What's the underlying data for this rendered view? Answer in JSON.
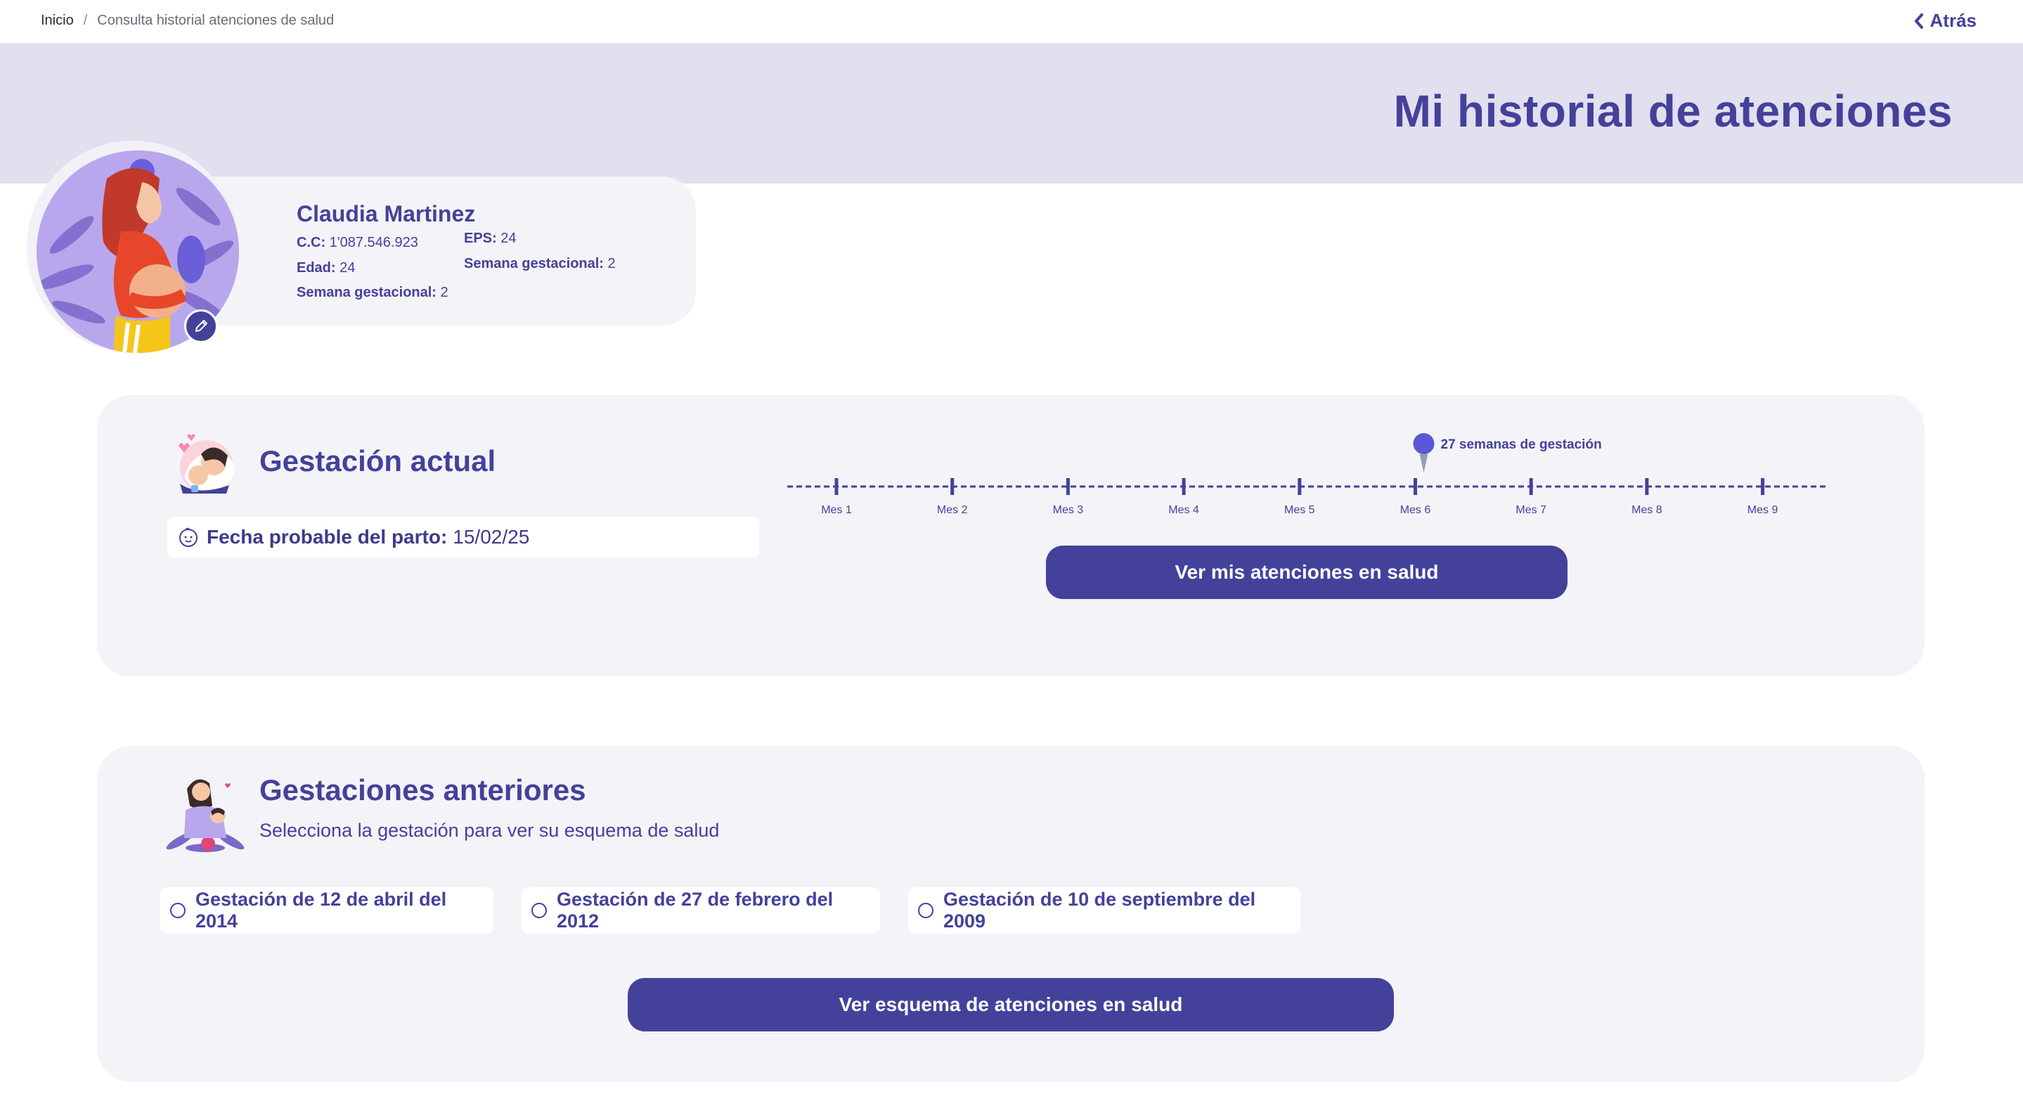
{
  "breadcrumb": {
    "home": "Inicio",
    "separator": "/",
    "current": "Consulta historial atenciones de salud"
  },
  "header": {
    "back_label": "Atrás",
    "title": "Mi historial de atenciones"
  },
  "profile": {
    "name": "Claudia Martinez",
    "cc_label": "C.C:",
    "cc_value": "1'087.546.923",
    "age_label": "Edad:",
    "age_value": "24",
    "week_label": "Semana gestacional:",
    "week_value": "2",
    "eps_label": "EPS:",
    "eps_value": "24",
    "week2_label": "Semana gestacional:",
    "week2_value": "2"
  },
  "current_pregnancy": {
    "title": "Gestación actual",
    "due_label": "Fecha probable del parto:",
    "due_value": "15/02/25",
    "marker_label": "27 semanas de gestación",
    "marker_position_months": 6,
    "months": [
      "Mes 1",
      "Mes 2",
      "Mes 3",
      "Mes 4",
      "Mes 5",
      "Mes 6",
      "Mes 7",
      "Mes 8",
      "Mes 9"
    ],
    "button_label": "Ver mis atenciones en salud"
  },
  "previous_pregnancies": {
    "title": "Gestaciones anteriores",
    "subtitle": "Selecciona la gestación para ver su esquema de salud",
    "options": [
      "Gestación de 12 de abril del 2014",
      "Gestación de 27 de febrero del 2012",
      "Gestación de 10 de septiembre del 2009"
    ],
    "button_label": "Ver esquema de atenciones en salud"
  },
  "colors": {
    "primary": "#44419a",
    "banner": "#e2dfef",
    "card": "#f4f3f8"
  },
  "icons": [
    "chevron-left-icon",
    "pencil-icon",
    "baby-face-icon",
    "location-pin-icon"
  ]
}
